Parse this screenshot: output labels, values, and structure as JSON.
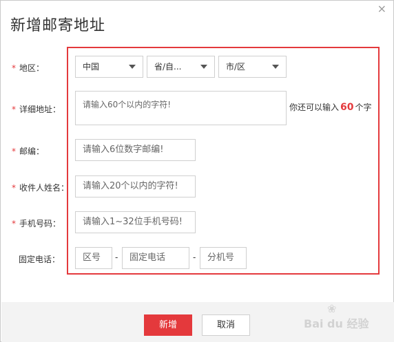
{
  "dialog": {
    "title": "新增邮寄地址",
    "close_symbol": "×"
  },
  "form": {
    "region": {
      "label": "地区：",
      "required": "*",
      "country": "中国",
      "province": "省/自...",
      "city": "市/区"
    },
    "address": {
      "label": "详细地址：",
      "required": "*",
      "placeholder": "请输入60个以内的字符!",
      "counter_prefix": "你还可以输入",
      "counter_value": "60",
      "counter_suffix": "个字"
    },
    "postcode": {
      "label": "邮编：",
      "required": "*",
      "placeholder": "请输入6位数字邮编!"
    },
    "recipient": {
      "label": "收件人姓名：",
      "required": "*",
      "placeholder": "请输入20个以内的字符!"
    },
    "mobile": {
      "label": "手机号码：",
      "required": "*",
      "placeholder": "请输入1~32位手机号码!"
    },
    "landline": {
      "label": "固定电话：",
      "area_code_placeholder": "区号",
      "number_placeholder": "固定电话",
      "extension_placeholder": "分机号",
      "separator": "-"
    }
  },
  "footer": {
    "submit_label": "新增",
    "cancel_label": "取消"
  },
  "watermark": {
    "text": "Bai du 经验"
  },
  "colors": {
    "accent": "#e4393c",
    "footer_bg": "#f3f3f3",
    "border": "#cfcfcf"
  }
}
